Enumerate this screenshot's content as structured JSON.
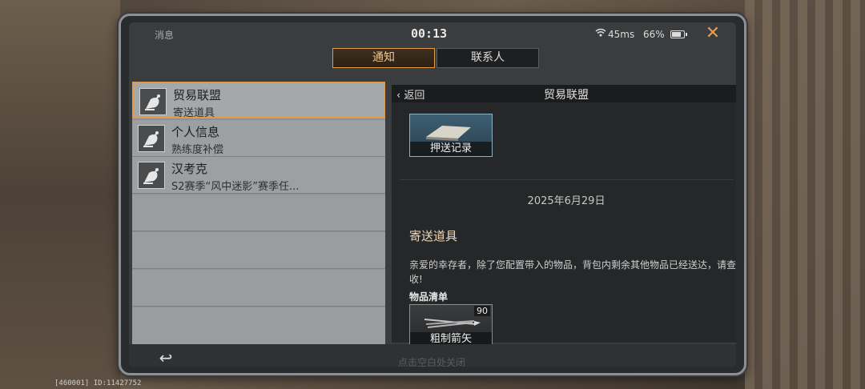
{
  "status_bar": {
    "title": "消息",
    "time": "00:13",
    "wifi_icon": "wifi-icon",
    "ping": "45ms",
    "battery_percent": "66%",
    "battery_level": 0.66,
    "close_symbol": "✕"
  },
  "tabs": [
    {
      "label": "通知",
      "active": true
    },
    {
      "label": "联系人",
      "active": false
    }
  ],
  "list": {
    "items": [
      {
        "title": "贸易联盟",
        "subtitle": "寄送道具",
        "icon": "satellite-dish-icon",
        "selected": true
      },
      {
        "title": "个人信息",
        "subtitle": "熟练度补偿",
        "icon": "satellite-dish-icon",
        "selected": false
      },
      {
        "title": "汉考克",
        "subtitle": "S2赛季“风中迷影”赛季任...",
        "icon": "satellite-dish-icon",
        "selected": false
      }
    ]
  },
  "detail": {
    "back_label": "返回",
    "title": "贸易联盟",
    "record_card_label": "押送记录",
    "date": "2025年6月29日",
    "subject": "寄送道具",
    "body": "亲爱的幸存者，除了您配置带入的物品，背包内剩余其他物品已经送达，请查收!",
    "item_list_label": "物品清单",
    "items": [
      {
        "name": "粗制箭矢",
        "count": "90",
        "icon": "arrow-bundle-icon"
      }
    ]
  },
  "footer": {
    "back_symbol": "↩",
    "hint": "点击空白处关闭",
    "device_info": "[460001] ID:11427752"
  }
}
